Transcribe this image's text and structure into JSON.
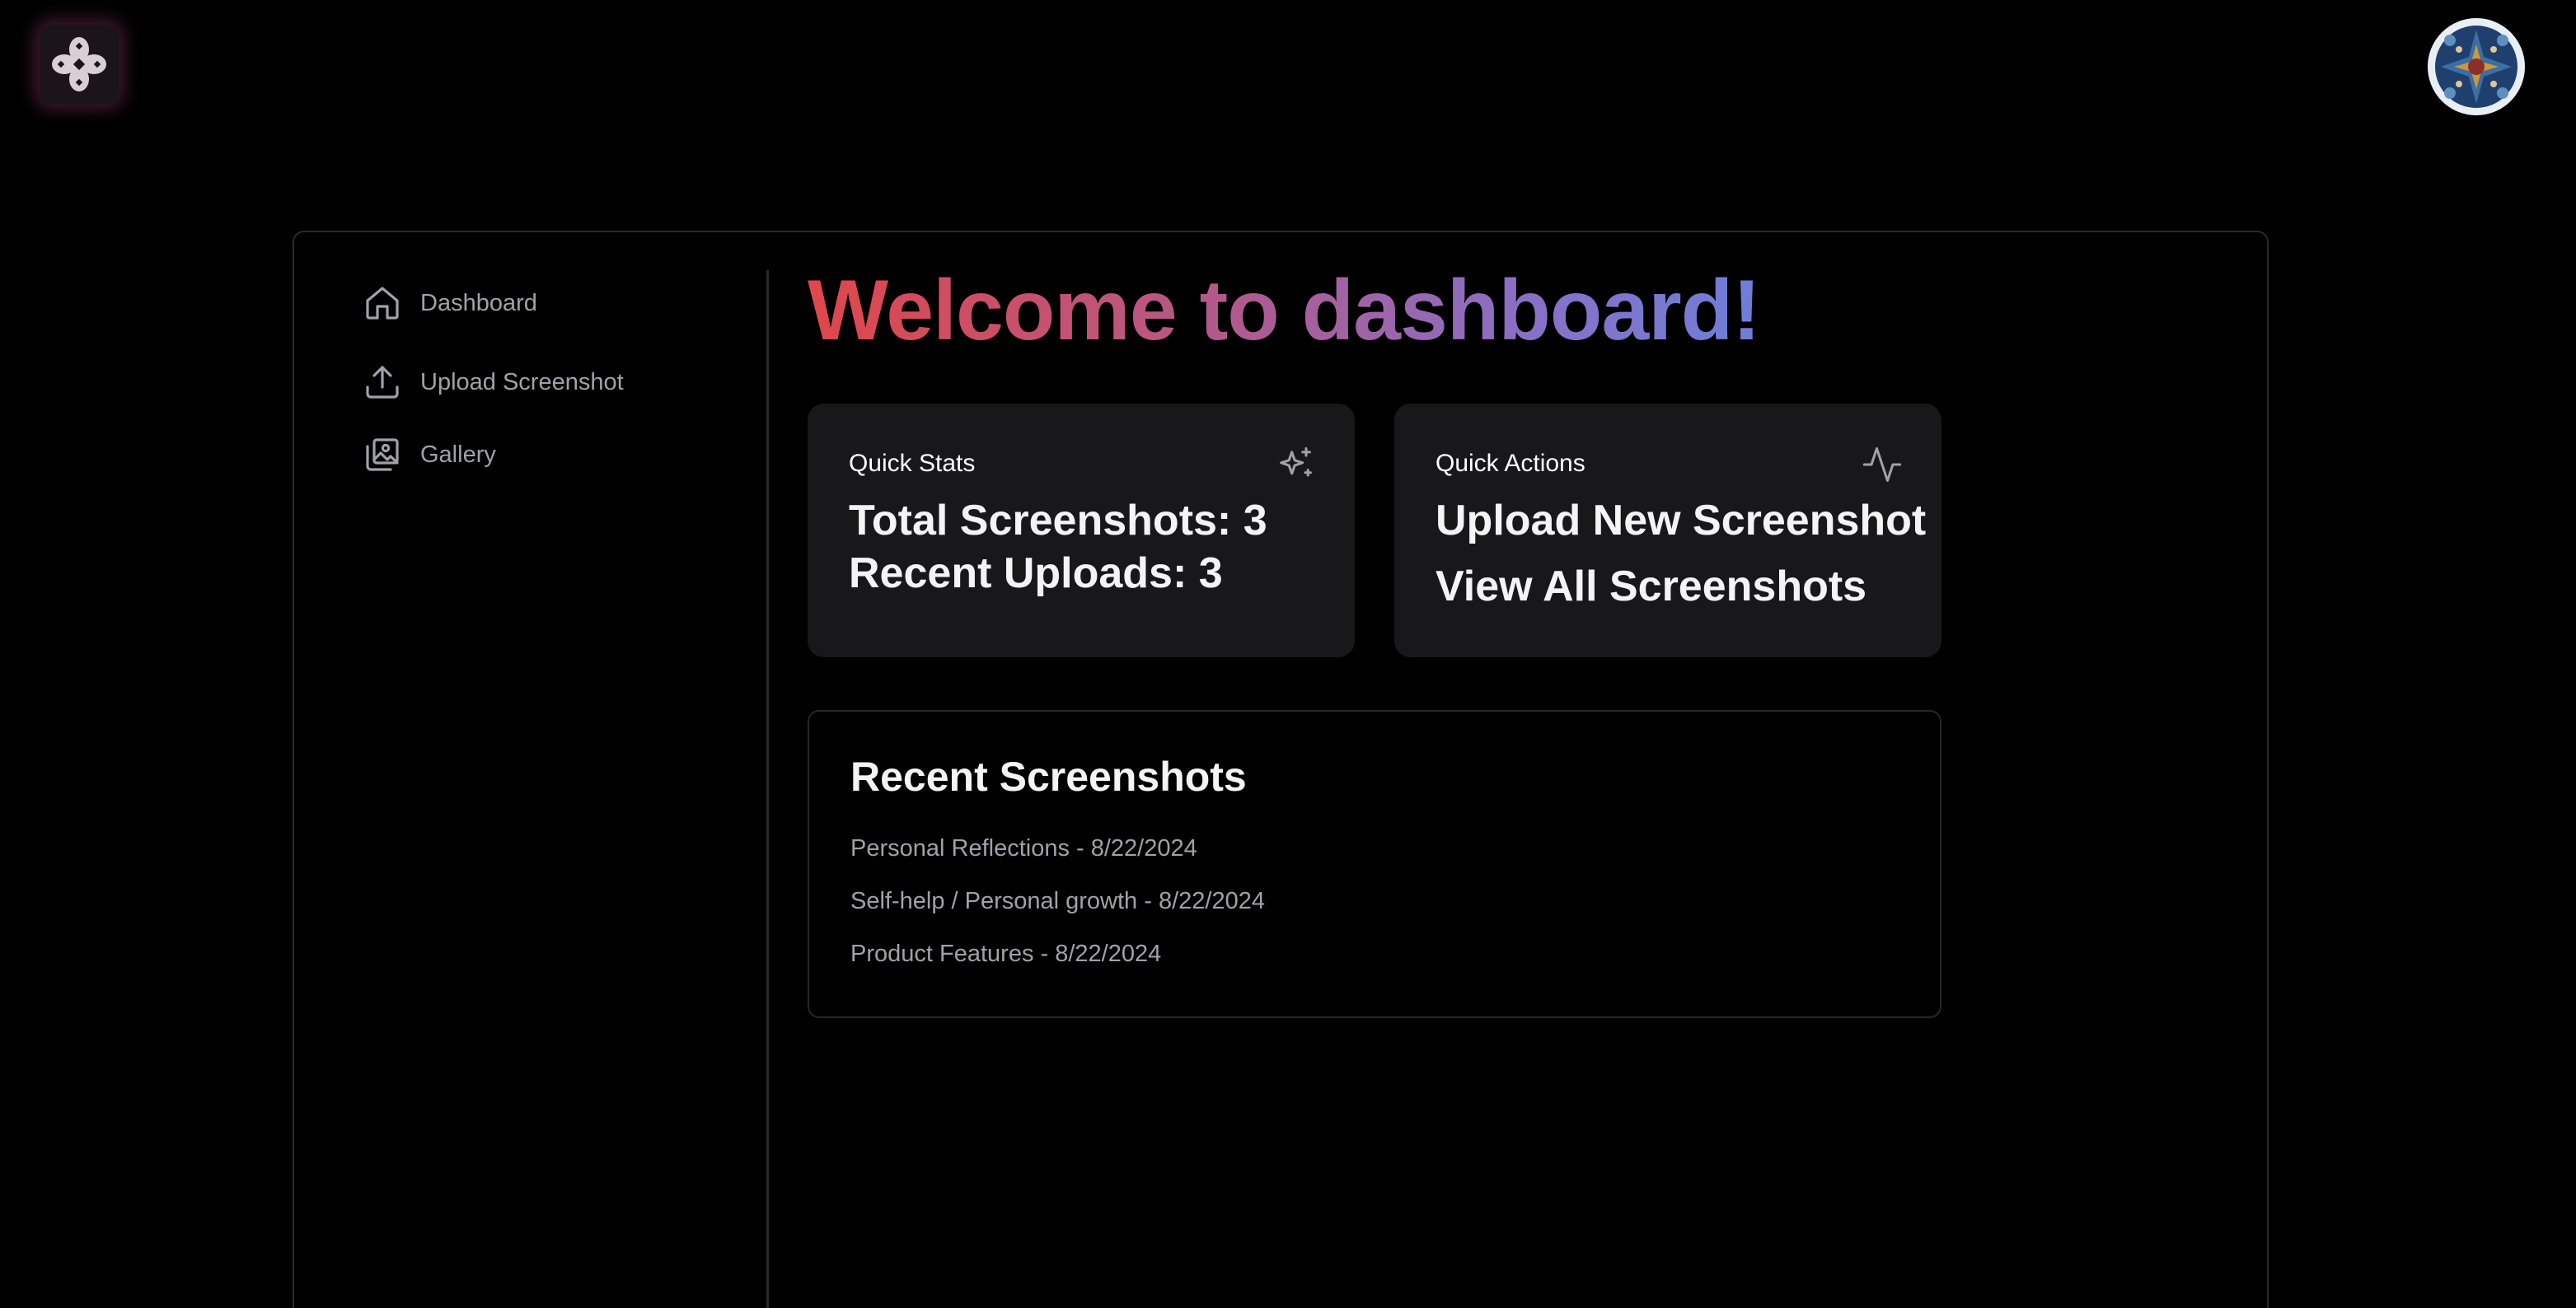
{
  "header": {
    "logo_icon": "flower-logo-icon",
    "avatar_icon": "mosaic-avatar-icon"
  },
  "sidebar": {
    "items": [
      {
        "label": "Dashboard",
        "icon": "home-icon"
      },
      {
        "label": "Upload Screenshot",
        "icon": "upload-icon"
      },
      {
        "label": "Gallery",
        "icon": "gallery-icon"
      }
    ]
  },
  "main": {
    "title": "Welcome to dashboard!",
    "quick_stats": {
      "label": "Quick Stats",
      "icon": "sparkles-icon",
      "total": "Total Screenshots: 3",
      "recent": "Recent Uploads: 3"
    },
    "quick_actions": {
      "label": "Quick Actions",
      "icon": "activity-icon",
      "upload": "Upload New Screenshot",
      "view_all": "View All Screenshots"
    },
    "recent_screenshots": {
      "title": "Recent Screenshots",
      "items": [
        "Personal Reflections - 8/22/2024",
        "Self-help / Personal growth - 8/22/2024",
        "Product Features - 8/22/2024"
      ]
    }
  },
  "colors": {
    "background": "#000000",
    "card": "#18181b",
    "muted_text": "#a1a1aa",
    "gradient_start": "#e0474a",
    "gradient_end": "#6d7fd8"
  }
}
